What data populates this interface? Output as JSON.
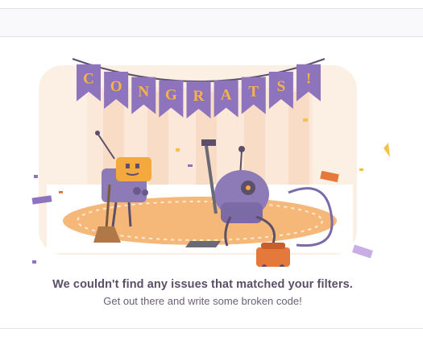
{
  "empty_state": {
    "banner_letters": [
      "C",
      "O",
      "N",
      "G",
      "R",
      "A",
      "T",
      "S",
      "!"
    ],
    "title": "We couldn't find any issues that matched your filters.",
    "subtitle": "Get out there and write some broken code!"
  },
  "colors": {
    "pennant": "#8e73bd",
    "pennant_letter": "#f6b449",
    "rug": "#f6b879",
    "robot_body": "#8d7bb8",
    "vacuum": "#e5793c",
    "text_title": "#5a4f66",
    "text_sub": "#6b6078"
  },
  "icons": {
    "illustration": "congrats-robots-illustration"
  }
}
